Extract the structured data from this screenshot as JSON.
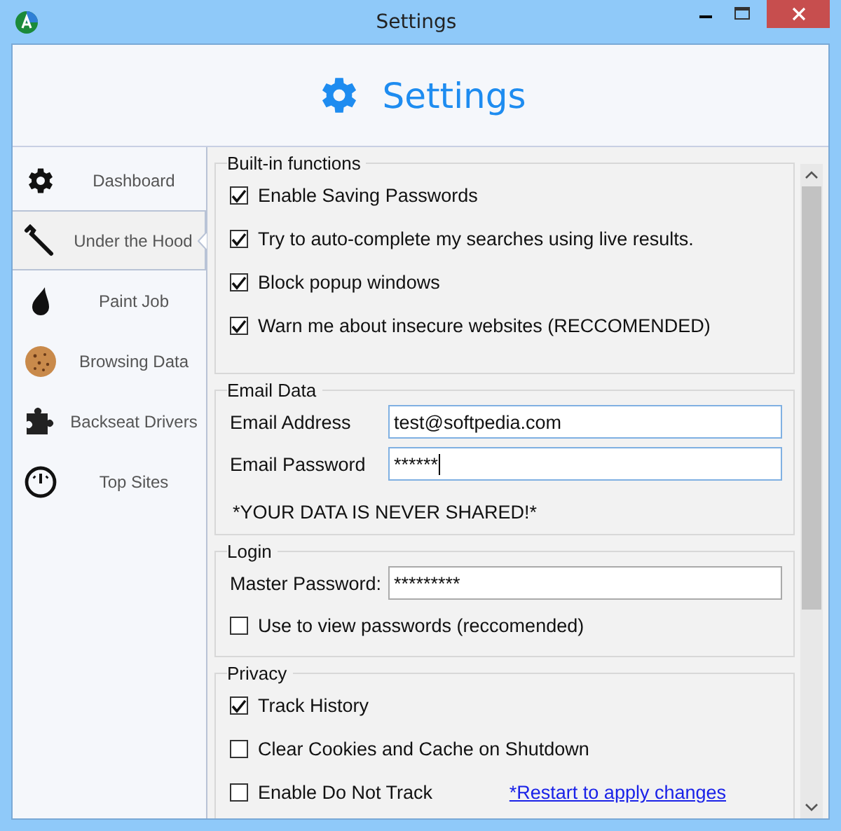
{
  "window": {
    "title": "Settings"
  },
  "header": {
    "title": "Settings"
  },
  "sidebar": {
    "items": [
      {
        "label": "Dashboard",
        "selected": false
      },
      {
        "label": "Under the Hood",
        "selected": true
      },
      {
        "label": "Paint Job",
        "selected": false
      },
      {
        "label": "Browsing Data",
        "selected": false
      },
      {
        "label": "Backseat Drivers",
        "selected": false
      },
      {
        "label": "Top Sites",
        "selected": false
      }
    ]
  },
  "groups": [
    {
      "title": "Built-in functions",
      "rows": [
        {
          "kind": "checkbox",
          "label": "Enable Saving Passwords",
          "checked": true
        },
        {
          "kind": "checkbox",
          "label": "Try to auto-complete my searches using live results.",
          "checked": true
        },
        {
          "kind": "checkbox",
          "label": "Block popup windows",
          "checked": true
        },
        {
          "kind": "checkbox",
          "label": "Warn me about insecure websites (RECCOMENDED)",
          "checked": true
        }
      ]
    },
    {
      "title": "Email Data",
      "rows": [
        {
          "kind": "field",
          "label": "Email Address",
          "value": "test@softpedia.com",
          "focused": true
        },
        {
          "kind": "field",
          "label": "Email Password",
          "value": "******",
          "focused": true
        },
        {
          "kind": "note",
          "text": "*YOUR DATA IS NEVER SHARED!*"
        }
      ]
    },
    {
      "title": "Login",
      "rows": [
        {
          "kind": "field",
          "label": "Master Password:",
          "value": "*********",
          "focused": false
        },
        {
          "kind": "checkbox",
          "label": "Use to view passwords (reccomended)",
          "checked": false
        }
      ]
    },
    {
      "title": "Privacy",
      "rows": [
        {
          "kind": "checkbox",
          "label": "Track History",
          "checked": true
        },
        {
          "kind": "checkbox",
          "label": "Clear Cookies and Cache on Shutdown",
          "checked": false
        },
        {
          "kind": "checkbox",
          "label": "Enable Do Not Track",
          "checked": false,
          "link": "*Restart to apply changes"
        }
      ]
    }
  ]
}
